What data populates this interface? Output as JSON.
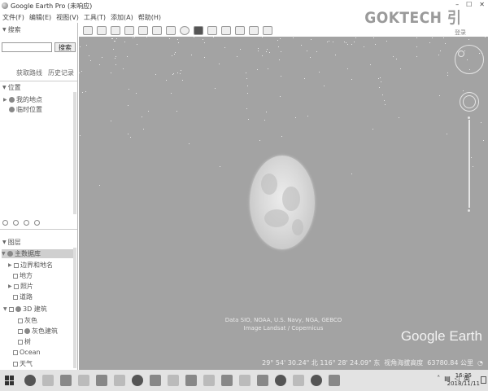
{
  "window": {
    "title": "Google Earth Pro (未响应)",
    "controls": [
      "–",
      "☐",
      "✕"
    ]
  },
  "menu": [
    "文件(F)",
    "编辑(E)",
    "视图(V)",
    "工具(T)",
    "添加(A)",
    "帮助(H)"
  ],
  "watermark": {
    "logo": "GOKTECH",
    "logo_cn": "引",
    "sub": "登录"
  },
  "sidebar": {
    "search_header": "搜索",
    "search_button": "搜索",
    "search_value": "",
    "subtabs": [
      "获取路线",
      "历史记录"
    ],
    "places_header": "位置",
    "places": [
      {
        "label": "我的地点"
      },
      {
        "label": "临时位置"
      }
    ],
    "layers_header": "图层",
    "layers": [
      {
        "label": "主数据库",
        "level": 0,
        "selected": true
      },
      {
        "label": "边界和地名",
        "level": 1
      },
      {
        "label": "地方",
        "level": 1
      },
      {
        "label": "照片",
        "level": 1
      },
      {
        "label": "道路",
        "level": 1
      },
      {
        "label": "3D 建筑",
        "level": 1
      },
      {
        "label": "灰色",
        "level": 2
      },
      {
        "label": "灰色建筑",
        "level": 2
      },
      {
        "label": "树",
        "level": 2
      },
      {
        "label": "Ocean",
        "level": 1
      },
      {
        "label": "天气",
        "level": 1
      }
    ]
  },
  "map": {
    "attribution_line1": "Data SIO, NOAA, U.S. Navy, NGA, GEBCO",
    "attribution_line2": "Image Landsat / Copernicus",
    "brand": "Google Earth",
    "status": {
      "coords": "29° 54' 30.24\" 北  116° 28' 24.09\" 东",
      "eye_alt_label": "视角海拔高度",
      "eye_alt_value": "63780.84 公里"
    }
  },
  "taskbar": {
    "tray_ime": "英",
    "clock_time": "16:35",
    "clock_date": "2018/11/11"
  }
}
